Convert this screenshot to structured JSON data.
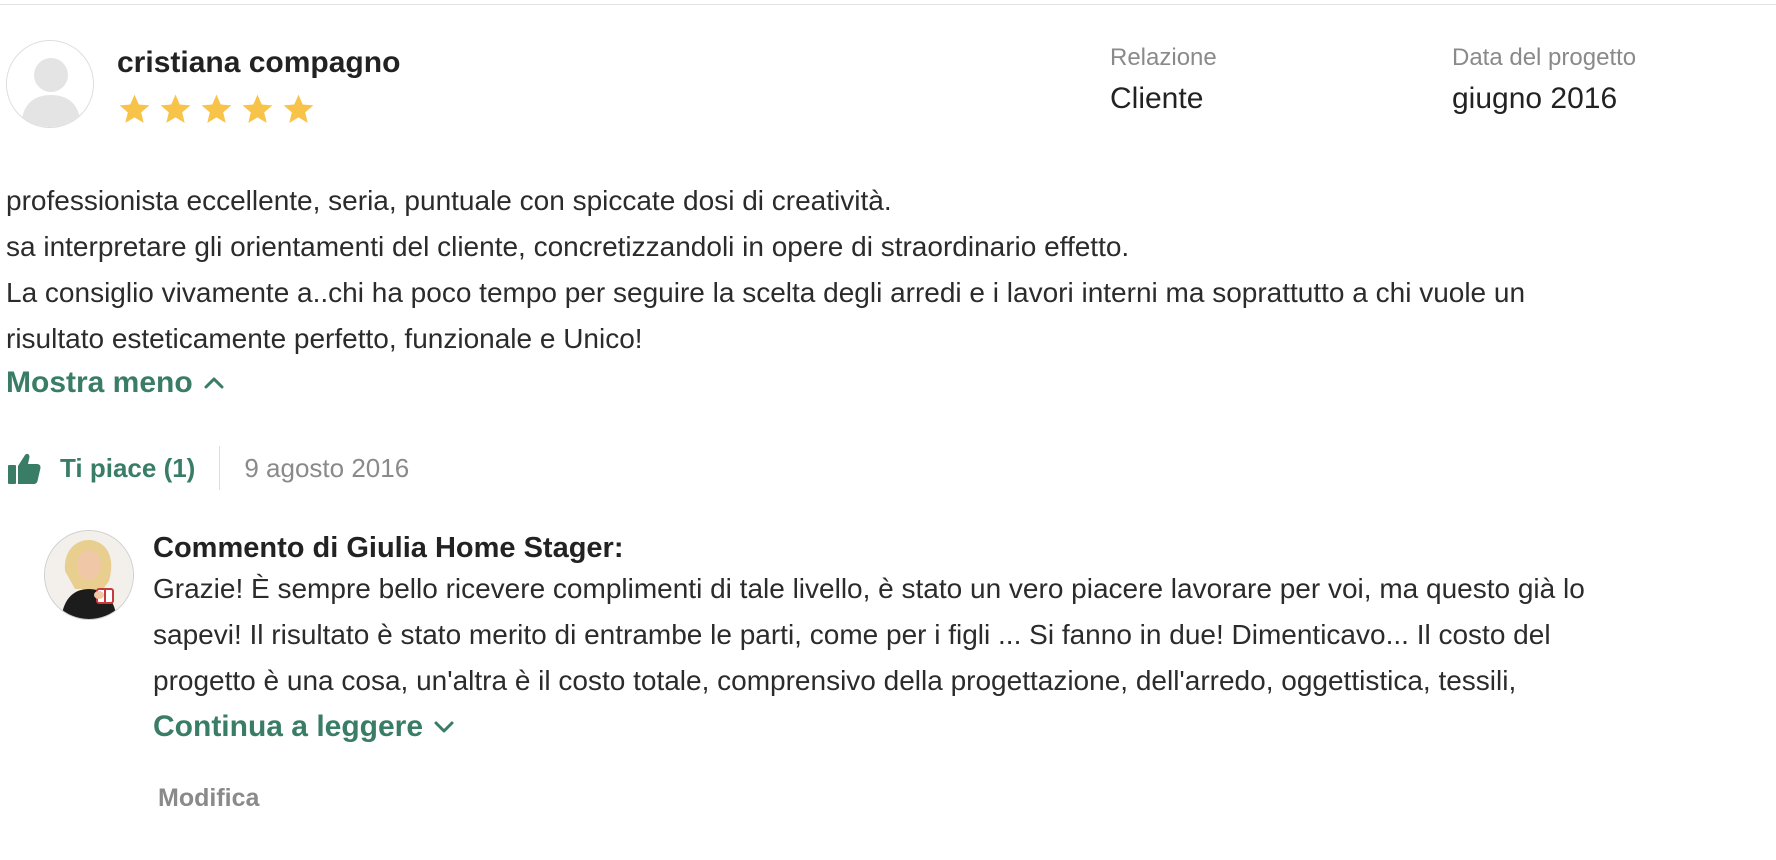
{
  "review": {
    "reviewer_name": "cristiana compagno",
    "rating": 5,
    "rating_max": 5,
    "star_color": "#f7c349",
    "relation_label": "Relazione",
    "relation_value": "Cliente",
    "project_date_label": "Data del progetto",
    "project_date_value": "giugno 2016",
    "body_lines": [
      "professionista eccellente, seria, puntuale con spiccate dosi di creatività.",
      "sa interpretare gli orientamenti del cliente, concretizzandoli in opere di straordinario effetto.",
      "La consiglio vivamente a..chi ha poco tempo per seguire la scelta degli arredi e i lavori interni ma soprattutto a chi vuole un",
      "risultato esteticamente perfetto, funzionale e Unico!"
    ],
    "show_less_label": "Mostra meno",
    "like_label": "Ti piace (1)",
    "date": "9 agosto 2016"
  },
  "comment": {
    "title": "Commento di Giulia Home Stager:",
    "text_lines": [
      "Grazie! È sempre bello ricevere complimenti di tale livello, è stato un vero piacere lavorare per voi, ma questo già lo",
      "sapevi! Il risultato è stato merito di entrambe le parti, come per i figli ... Si fanno in due! Dimenticavo... Il costo del",
      "progetto è una cosa, un'altra è il costo totale, comprensivo della progettazione, dell'arredo, oggettistica, tessili,"
    ],
    "continue_label": "Continua a leggere",
    "edit_label": "Modifica"
  },
  "colors": {
    "accent_green": "#3a7d66",
    "muted_gray": "#8a8a8a",
    "text_dark": "#222222"
  },
  "icons": {
    "avatar_placeholder": "default-user-avatar",
    "star": "star-icon",
    "chevron_up": "chevron-up-icon",
    "chevron_down": "chevron-down-icon",
    "like": "thumbs-up-icon",
    "commenter_avatar": "commenter-photo"
  }
}
